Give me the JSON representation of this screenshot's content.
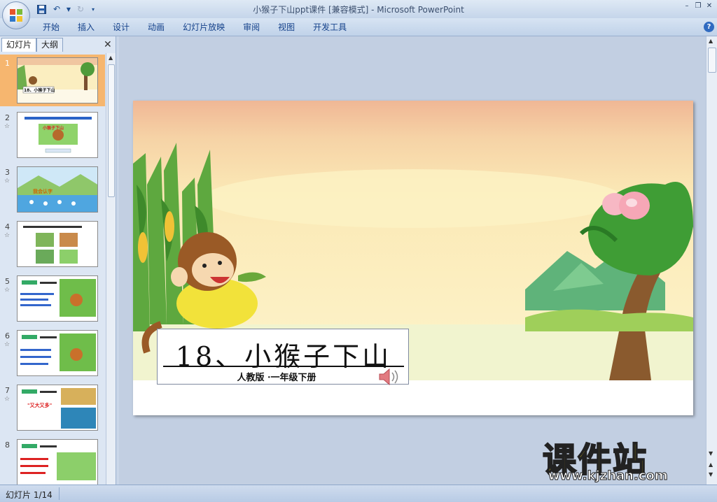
{
  "window": {
    "title": "小猴子下山ppt课件 [兼容模式] - Microsoft PowerPoint"
  },
  "quick_access": [
    {
      "name": "save-icon",
      "glyph": "💾"
    },
    {
      "name": "undo-icon",
      "glyph": "↶"
    },
    {
      "name": "redo-icon",
      "glyph": "↻"
    }
  ],
  "ribbon": {
    "tabs": [
      "开始",
      "插入",
      "设计",
      "动画",
      "幻灯片放映",
      "审阅",
      "视图",
      "开发工具"
    ],
    "help_label": "?"
  },
  "slide_pane": {
    "tab_slides": "幻灯片",
    "tab_outline": "大纲",
    "close_label": "✕",
    "thumbnails": [
      {
        "number": "1",
        "selected": true,
        "has_animation": false,
        "caption": "18、小猴子下山"
      },
      {
        "number": "2",
        "selected": false,
        "has_animation": true,
        "caption": "小猴子下山"
      },
      {
        "number": "3",
        "selected": false,
        "has_animation": true,
        "caption": "我会认字"
      },
      {
        "number": "4",
        "selected": false,
        "has_animation": true,
        "caption": ""
      },
      {
        "number": "5",
        "selected": false,
        "has_animation": true,
        "caption": ""
      },
      {
        "number": "6",
        "selected": false,
        "has_animation": true,
        "caption": ""
      },
      {
        "number": "7",
        "selected": false,
        "has_animation": true,
        "caption": "\"又大又多\""
      },
      {
        "number": "8",
        "selected": false,
        "has_animation": false,
        "caption": ""
      }
    ]
  },
  "slide": {
    "title": "18、小猴子下山",
    "subtitle": "人教版 ·一年级下册"
  },
  "watermark": {
    "title": "课件站",
    "url": "www.kjzhan.com"
  },
  "status": {
    "slide_counter": "幻灯片 1/14"
  },
  "colors": {
    "selected_thumb": "#f6b66f",
    "ribbon_text": "#15428b",
    "watermark_yellow": "#f7e01a"
  }
}
